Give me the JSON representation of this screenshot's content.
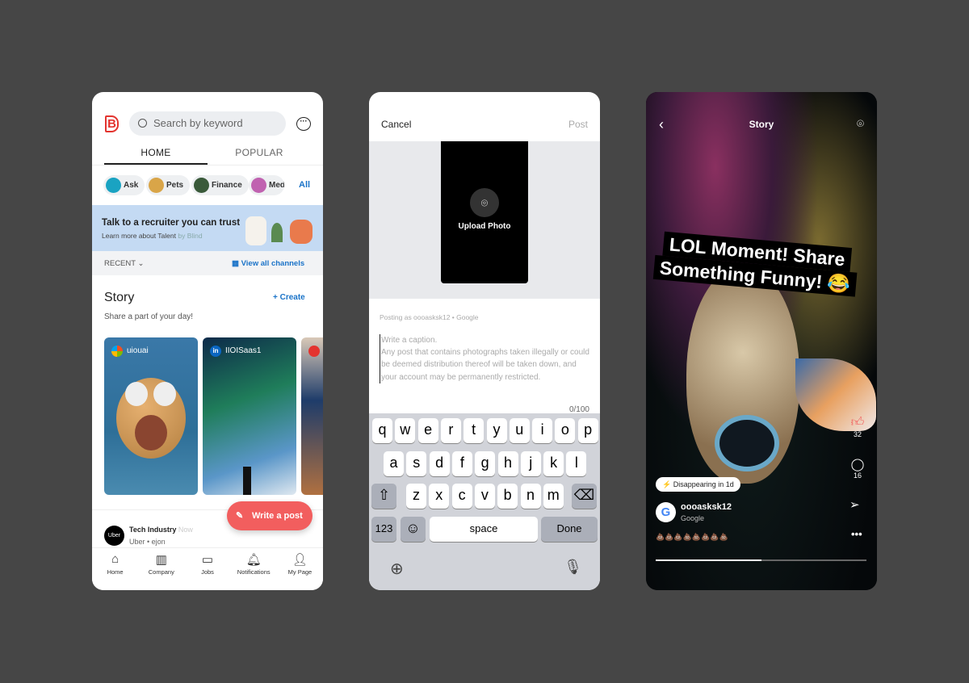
{
  "home": {
    "search_placeholder": "Search by keyword",
    "tabs": [
      "HOME",
      "POPULAR"
    ],
    "chips": [
      {
        "label": "Ask",
        "color": "#1aa3c2"
      },
      {
        "label": "Pets",
        "color": "#d9a548"
      },
      {
        "label": "Finance",
        "color": "#3a5a3a"
      },
      {
        "label": "Med",
        "color": "#c062b0"
      }
    ],
    "chips_all": "All",
    "banner": {
      "title": "Talk to a recruiter you can trust",
      "sub": "Learn more about Talent",
      "by": "by Blind"
    },
    "recent": "RECENT",
    "view_all": "View all channels",
    "story": {
      "title": "Story",
      "create": "+ Create",
      "sub": "Share a part of your day!",
      "cards": [
        {
          "name": "uiouai"
        },
        {
          "name": "IIOISaas1"
        },
        {
          "name": ""
        }
      ]
    },
    "write_post": "Write a post",
    "post": {
      "channel": "Tech Industry",
      "time": "Now",
      "meta": "Uber • ejon",
      "avatar": "Uber"
    },
    "nav": [
      "Home",
      "Company",
      "Jobs",
      "Notifications",
      "My Page"
    ],
    "accent": "#1a73c8",
    "fab_color": "#f25e5e"
  },
  "compose": {
    "cancel": "Cancel",
    "post": "Post",
    "upload": "Upload Photo",
    "posting_as": "Posting as oooasksk12 • Google",
    "caption_placeholder": "Write a caption.",
    "caption_note": "Any post that contains photographs taken illegally or could be deemed distribution thereof will be taken down, and your account may be permanently restricted.",
    "counter": "0/100",
    "keyboard": {
      "row1": [
        "q",
        "w",
        "e",
        "r",
        "t",
        "y",
        "u",
        "i",
        "o",
        "p"
      ],
      "row2": [
        "a",
        "s",
        "d",
        "f",
        "g",
        "h",
        "j",
        "k",
        "l"
      ],
      "row3": [
        "z",
        "x",
        "c",
        "v",
        "b",
        "n",
        "m"
      ],
      "num": "123",
      "space": "space",
      "done": "Done"
    }
  },
  "story_view": {
    "title": "Story",
    "overlay_line1": "LOL Moment! Share",
    "overlay_line2": "Something Funny! 😂",
    "likes": "32",
    "comments": "16",
    "badge": "Disappearing in 1d",
    "user": "oooasksk12",
    "company": "Google",
    "emoji": "💩💩💩💩💩💩💩💩",
    "progress": 0.5
  }
}
